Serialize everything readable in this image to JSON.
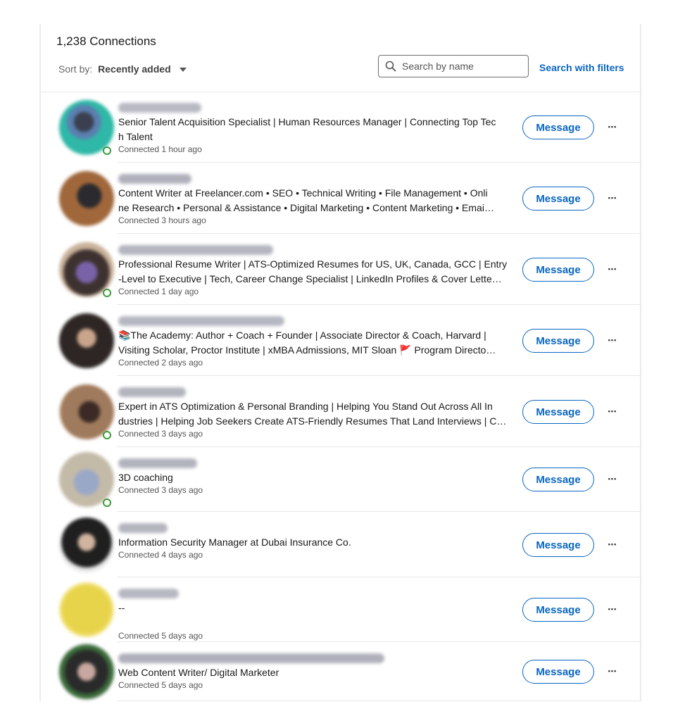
{
  "header": {
    "count": "1,238 Connections",
    "sort_label": "Sort by:",
    "sort_value": "Recently added",
    "search_placeholder": "Search by name",
    "filters_link": "Search with filters"
  },
  "button_label": "Message",
  "more_icon": "more-horizontal-icon",
  "colors": {
    "accent": "#0a66c2",
    "online": "#3a9e3a"
  },
  "connections": [
    {
      "headline_1": "Senior Talent Acquisition Specialist | Human Resources Manager | Connecting Top Tec",
      "headline_2": "h Talent",
      "connected": "Connected 1 hour ago"
    },
    {
      "headline_1": "Content Writer at Freelancer.com • SEO • Technical Writing • File Management • Onli",
      "headline_2": "ne Research • Personal & Assistance • Digital Marketing • Content Marketing • Emai…",
      "connected": "Connected 3 hours ago"
    },
    {
      "headline_1": "Professional Resume Writer | ATS-Optimized Resumes for US, UK, Canada, GCC | Entry",
      "headline_2": "-Level to Executive | Tech, Career Change Specialist | LinkedIn Profiles & Cover Lette…",
      "connected": "Connected 1 day ago"
    },
    {
      "headline_1": "📚The Academy: Author + Coach + Founder | Associate Director & Coach, Harvard |",
      "headline_2": "Visiting Scholar, Proctor Institute | xMBA Admissions, MIT Sloan 🚩 Program Directo…",
      "connected": "Connected 2 days ago"
    },
    {
      "headline_1": "Expert in ATS Optimization & Personal Branding | Helping You Stand Out Across All In",
      "headline_2": "dustries | Helping Job Seekers Create ATS-Friendly Resumes That Land Interviews | C…",
      "connected": "Connected 3 days ago"
    },
    {
      "headline_1": "3D coaching",
      "headline_2": "",
      "connected": "Connected 3 days ago"
    },
    {
      "headline_1": "Information Security Manager at Dubai Insurance Co.",
      "headline_2": "",
      "connected": "Connected 4 days ago"
    },
    {
      "headline_1": "--",
      "headline_2": "",
      "connected": "Connected 5 days ago"
    },
    {
      "headline_1": "Web Content Writer/ Digital Marketer",
      "headline_2": "",
      "connected": "Connected 5 days ago"
    }
  ]
}
